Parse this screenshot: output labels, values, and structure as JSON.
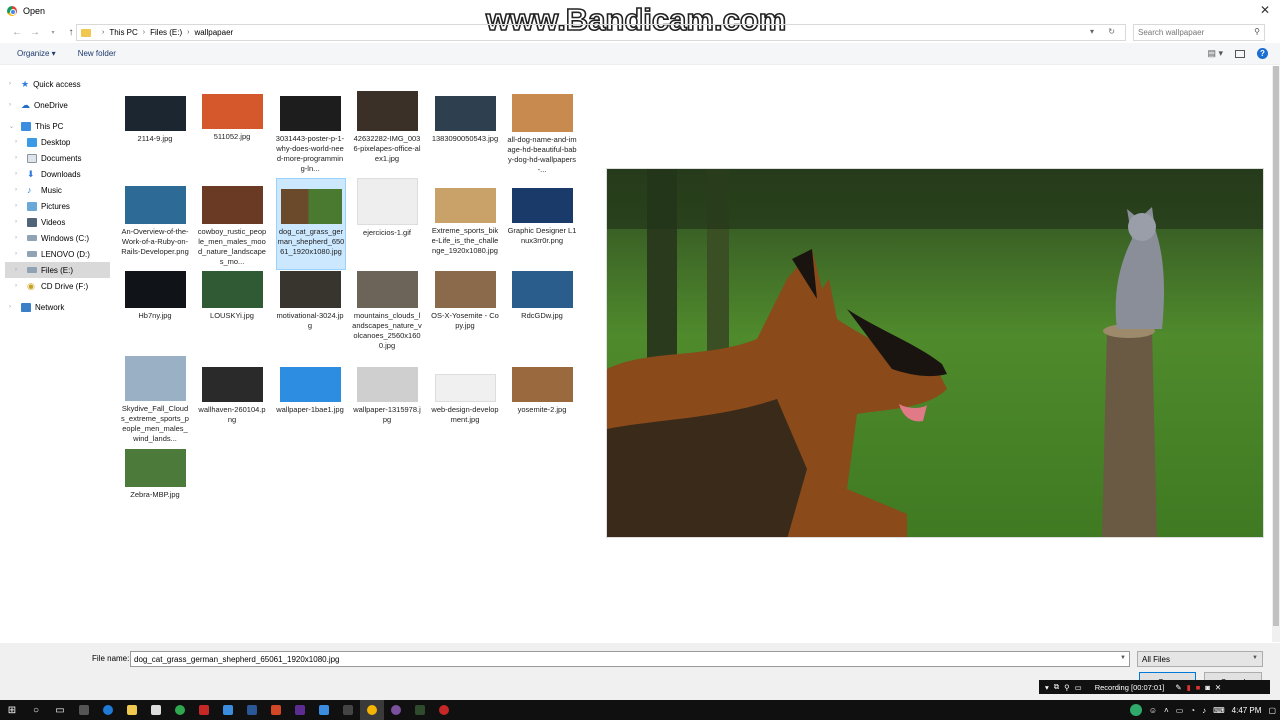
{
  "window": {
    "title": "Open"
  },
  "watermark": "www.Bandicam.com",
  "address": {
    "crumbs": [
      "This PC",
      "Files (E:)",
      "wallpapaer"
    ],
    "search_placeholder": "Search wallpapaer"
  },
  "toolbar": {
    "organize": "Organize ▾",
    "new_folder": "New folder"
  },
  "sidebar": {
    "items": [
      {
        "label": "Quick access",
        "icon": "star-icon"
      },
      {
        "label": "OneDrive",
        "icon": "cloud-icon"
      },
      {
        "label": "This PC",
        "icon": "computer-icon"
      },
      {
        "label": "Desktop",
        "icon": "desktop-icon"
      },
      {
        "label": "Documents",
        "icon": "documents-icon"
      },
      {
        "label": "Downloads",
        "icon": "downloads-icon"
      },
      {
        "label": "Music",
        "icon": "music-icon"
      },
      {
        "label": "Pictures",
        "icon": "pictures-icon"
      },
      {
        "label": "Videos",
        "icon": "videos-icon"
      },
      {
        "label": "Windows (C:)",
        "icon": "drive-icon"
      },
      {
        "label": "LENOVO (D:)",
        "icon": "drive-icon"
      },
      {
        "label": "Files (E:)",
        "icon": "drive-icon"
      },
      {
        "label": "CD Drive (F:)",
        "icon": "cd-drive-icon"
      },
      {
        "label": "Network",
        "icon": "network-icon"
      }
    ]
  },
  "files": [
    {
      "name": "2114-9.jpg",
      "color": "#1c2630"
    },
    {
      "name": "511052.jpg",
      "color": "#d5582c"
    },
    {
      "name": "3031443-poster-p-1-why-does-world-need-more-programming-ln...",
      "color": "#1d1d1d"
    },
    {
      "name": "42632282-IMG_0036-pixelapes-office-alex1.jpg",
      "color": "#3a3028"
    },
    {
      "name": "1383090050543.jpg",
      "color": "#2e3f4f"
    },
    {
      "name": "all-dog-name-and-image-hd-beautiful-baby-dog-hd-wallpapers-...",
      "color": "#c98a4f"
    },
    {
      "name": "An-Overview-of-the-Work-of-a-Ruby-on-Rails-Developer.png",
      "color": "#2e6a96"
    },
    {
      "name": "cowboy_rustic_people_men_males_mood_nature_landscapes_mo...",
      "color": "#6a3a24"
    },
    {
      "name": "dog_cat_grass_german_shepherd_65061_1920x1080.jpg",
      "color": "#4a7a30"
    },
    {
      "name": "ejercicios-1.gif",
      "color": "#eeeeee"
    },
    {
      "name": "Extreme_sports_bike-Life_is_the_challenge_1920x1080.jpg",
      "color": "#c9a26a"
    },
    {
      "name": "Graphic Designer L1nux3rr0r.png",
      "color": "#1a3a6a"
    },
    {
      "name": "Hb7ny.jpg",
      "color": "#101418"
    },
    {
      "name": "LOUSKYi.jpg",
      "color": "#2f5a34"
    },
    {
      "name": "motivational-3024.jpg",
      "color": "#38342e"
    },
    {
      "name": "mountains_clouds_landscapes_nature_volcanoes_2560x1600.jpg",
      "color": "#6c6458"
    },
    {
      "name": "OS-X-Yosemite - Copy.jpg",
      "color": "#8a6a4a"
    },
    {
      "name": "RdcGDw.jpg",
      "color": "#2a5d8c"
    },
    {
      "name": "Skydive_Fall_Clouds_extreme_sports_people_men_males_wind_lands...",
      "color": "#9ab0c4"
    },
    {
      "name": "wallhaven-260104.png",
      "color": "#2a2a2a"
    },
    {
      "name": "wallpaper-1bae1.jpg",
      "color": "#2d8de0"
    },
    {
      "name": "wallpaper-1315978.jpg",
      "color": "#cfcfcf"
    },
    {
      "name": "web-design-development.jpg",
      "color": "#f0f0f0"
    },
    {
      "name": "yosemite-2.jpg",
      "color": "#9a6a3e"
    },
    {
      "name": "Zebra-MBP.jpg",
      "color": "#4c7a3a"
    }
  ],
  "selected_file": "dog_cat_grass_german_shepherd_65061_1920x1080.jpg",
  "bottom": {
    "file_name_label": "File name:",
    "file_name_value": "dog_cat_grass_german_shepherd_65061_1920x1080.jpg",
    "filter_value": "All Files",
    "open_label": "Open",
    "cancel_label": "Cancel"
  },
  "recording": {
    "text": "Recording [00:07:01]"
  },
  "taskbar": {
    "time": "4:47 PM"
  },
  "colors": {
    "accent": "#0078d7",
    "selection": "#cce8ff",
    "taskbar": "#101010"
  }
}
